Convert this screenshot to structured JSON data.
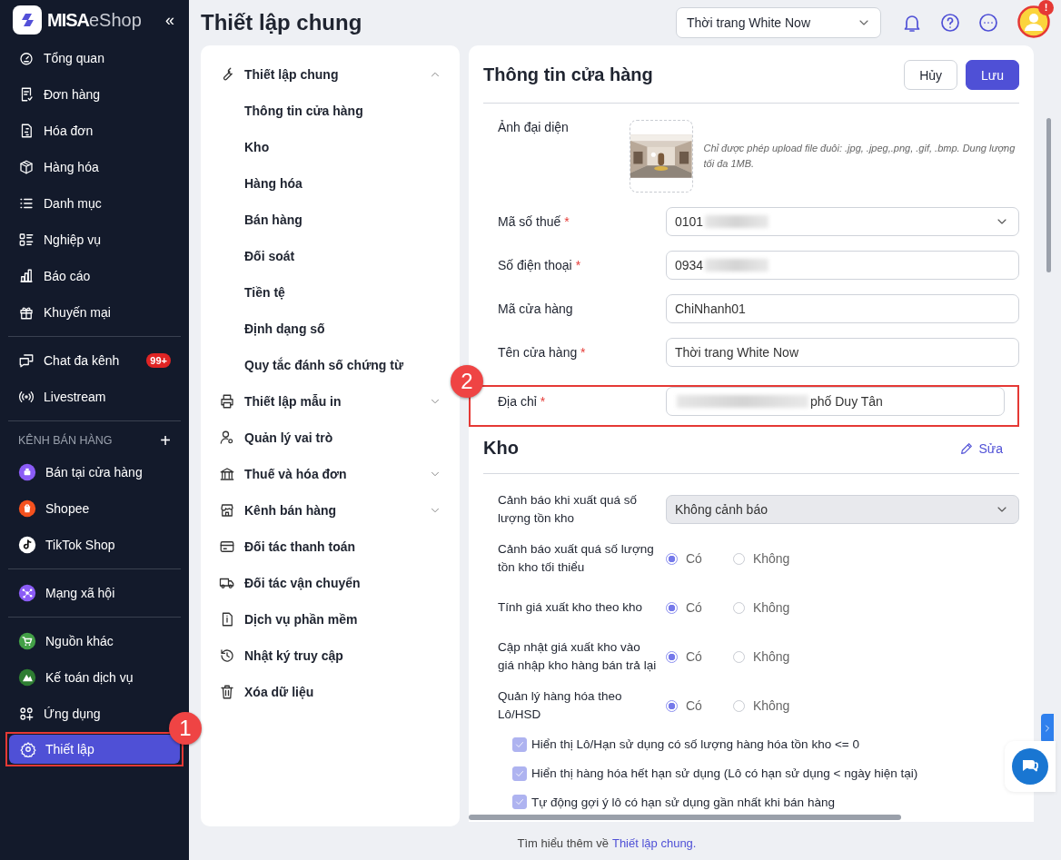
{
  "sidebar": {
    "logo": {
      "brand": "MISA",
      "product": "eShop"
    },
    "collapse": "«",
    "sections": [
      {
        "items": [
          {
            "label": "Tổng quan",
            "selected": false
          },
          {
            "label": "Đơn hàng",
            "selected": false
          },
          {
            "label": "Hóa đơn",
            "selected": false
          },
          {
            "label": "Hàng hóa",
            "selected": false
          },
          {
            "label": "Danh mục",
            "selected": false
          },
          {
            "label": "Nghiệp vụ",
            "selected": false
          },
          {
            "label": "Báo cáo",
            "selected": false
          },
          {
            "label": "Khuyến mại",
            "selected": false
          }
        ]
      },
      {
        "items": [
          {
            "label": "Chat đa kênh",
            "selected": false,
            "badge": "99+"
          },
          {
            "label": "Livestream",
            "selected": false
          }
        ]
      },
      {
        "heading": "KÊNH BÁN HÀNG",
        "action": "+",
        "items": [
          {
            "label": "Bán tại cửa hàng",
            "selected": false,
            "color": "#8b5cf6"
          },
          {
            "label": "Shopee",
            "selected": false,
            "color": "#f4511e"
          },
          {
            "label": "TikTok Shop",
            "selected": false,
            "color": "#ffffff"
          }
        ]
      },
      {
        "items": [
          {
            "label": "Mạng xã hội",
            "selected": false,
            "color": "#8b5cf6"
          }
        ]
      },
      {
        "items": [
          {
            "label": "Nguồn khác",
            "selected": false,
            "color": "#43a047"
          },
          {
            "label": "Kế toán dịch vụ",
            "selected": false,
            "color": "#2e7d32"
          },
          {
            "label": "Ứng dụng",
            "selected": false
          },
          {
            "label": "Thiết lập",
            "selected": true,
            "callout": "1"
          }
        ]
      }
    ]
  },
  "header": {
    "title": "Thiết lập chung",
    "store_select": "Thời trang White Now",
    "avatar_alert": "!"
  },
  "settings_menu": [
    {
      "label": "Thiết lập chung",
      "expanded": true,
      "children": [
        {
          "label": "Thông tin cửa hàng"
        },
        {
          "label": "Kho"
        },
        {
          "label": "Hàng hóa"
        },
        {
          "label": "Bán hàng"
        },
        {
          "label": "Đối soát"
        },
        {
          "label": "Tiền tệ"
        },
        {
          "label": "Định dạng số"
        },
        {
          "label": "Quy tắc đánh số chứng từ"
        }
      ]
    },
    {
      "label": "Thiết lập mẫu in",
      "expanded": false
    },
    {
      "label": "Quản lý vai trò"
    },
    {
      "label": "Thuế và hóa đơn",
      "expanded": false
    },
    {
      "label": "Kênh bán hàng",
      "expanded": false
    },
    {
      "label": "Đối tác thanh toán"
    },
    {
      "label": "Đối tác vận chuyển"
    },
    {
      "label": "Dịch vụ phần mềm"
    },
    {
      "label": "Nhật ký truy cập"
    },
    {
      "label": "Xóa dữ liệu"
    }
  ],
  "store_info": {
    "title": "Thông tin cửa hàng",
    "buttons": [
      {
        "label": "Hủy",
        "kind": "secondary"
      },
      {
        "label": "Lưu",
        "kind": "primary"
      }
    ],
    "fields": [
      {
        "label": "Ảnh đại diện",
        "hint": "Chỉ được phép upload file đuôi: .jpg, .jpeg,.png, .gif, .bmp. Dung lượng tối đa 1MB."
      },
      {
        "label": "Mã số thuế",
        "required_mark": "*",
        "kind": "select",
        "value_parts": [
          {
            "kind": "text",
            "text": "0101"
          },
          {
            "kind": "redacted"
          }
        ]
      },
      {
        "label": "Số điện thoại",
        "required_mark": "*",
        "kind": "text",
        "value_parts": [
          {
            "kind": "text",
            "text": "0934"
          },
          {
            "kind": "redacted"
          }
        ]
      },
      {
        "label": "Mã cửa hàng",
        "kind": "text",
        "value_parts": [
          {
            "kind": "text",
            "text": "ChiNhanh01"
          }
        ]
      },
      {
        "label": "Tên cửa hàng",
        "required_mark": "*",
        "kind": "text",
        "value_parts": [
          {
            "kind": "text",
            "text": "Thời trang White Now"
          }
        ]
      },
      {
        "label": "Địa chỉ",
        "required_mark": "*",
        "kind": "text",
        "value_parts": [
          {
            "kind": "redacted"
          },
          {
            "kind": "text",
            "text": "phố Duy Tân"
          }
        ],
        "callout": "2"
      }
    ]
  },
  "warehouse": {
    "title": "Kho",
    "edit": "Sửa",
    "settings": [
      {
        "label": "Cảnh báo khi xuất quá số lượng tồn kho",
        "kind": "select",
        "value": "Không cảnh báo"
      },
      {
        "label": "Cảnh báo xuất quá số lượng tồn kho tối thiểu",
        "kind": "radio",
        "options": [
          {
            "label": "Có",
            "selected": true
          },
          {
            "label": "Không",
            "selected": false
          }
        ]
      },
      {
        "label": "Tính giá xuất kho theo kho",
        "kind": "radio",
        "options": [
          {
            "label": "Có",
            "selected": true
          },
          {
            "label": "Không",
            "selected": false
          }
        ]
      },
      {
        "label": "Cập nhật giá xuất kho vào giá nhập kho hàng bán trả lại",
        "kind": "radio",
        "options": [
          {
            "label": "Có",
            "selected": true
          },
          {
            "label": "Không",
            "selected": false
          }
        ]
      },
      {
        "label": "Quản lý hàng hóa theo Lô/HSD",
        "kind": "radio",
        "options": [
          {
            "label": "Có",
            "selected": true
          },
          {
            "label": "Không",
            "selected": false
          }
        ]
      }
    ],
    "checkboxes": [
      {
        "label": "Hiển thị Lô/Hạn sử dụng có số lượng hàng hóa tồn kho <= 0",
        "checked": true,
        "disabled": true
      },
      {
        "label": "Hiển thị hàng hóa hết hạn sử dụng (Lô có hạn sử dụng < ngày hiện tại)",
        "checked": true,
        "disabled": true
      },
      {
        "label": "Tự động gợi ý lô có hạn sử dụng gần nhất khi bán hàng",
        "checked": true,
        "disabled": true
      }
    ]
  },
  "footer": {
    "text": "Tìm hiểu thêm về",
    "link": "Thiết lập chung."
  }
}
